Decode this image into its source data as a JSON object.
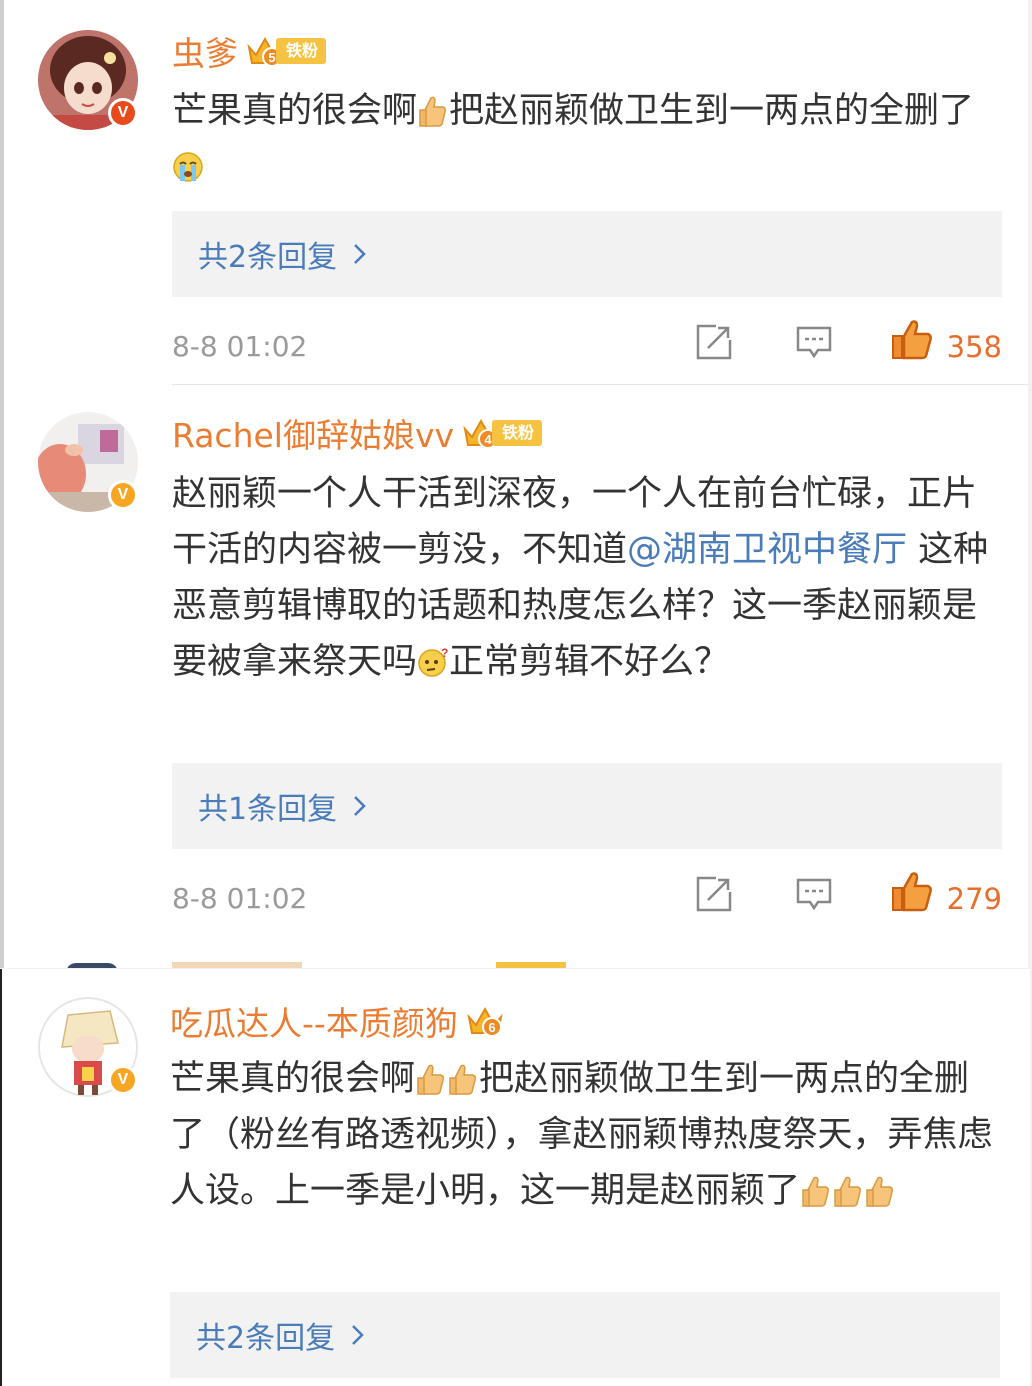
{
  "comments": [
    {
      "username": "虫爹",
      "fan_badge": "铁粉",
      "fan_level": "5",
      "verified": "V",
      "text_before": "芒果真的很会啊",
      "text_mid": "把赵丽颖做卫生到一两点的全删了",
      "reply_link": "共2条回复",
      "time": "8-8 01:02",
      "likes": "358"
    },
    {
      "username": "Rachel御辞姑娘vv",
      "fan_badge": "铁粉",
      "fan_level": "4",
      "verified": "V",
      "text_before": "赵丽颖一个人干活到深夜，一个人在前台忙碌，正片干活的内容被一剪没，不知道",
      "mention": "@湖南卫视中餐厅",
      "text_after": " 这种恶意剪辑博取的话题和热度怎么样？这一季赵丽颖是要被拿来祭天吗",
      "text_end": "正常剪辑不好么？",
      "reply_link": "共1条回复",
      "time": "8-8 01:02",
      "likes": "279"
    },
    {
      "username": "吃瓜达人--本质颜狗",
      "fan_level": "6",
      "verified": "V",
      "text_before": "芒果真的很会啊",
      "text_mid": "把赵丽颖做卫生到一两点的全删了（粉丝有路透视频），拿赵丽颖博热度祭天，弄焦虑人设。上一季是小明，这一期是赵丽颖了",
      "reply_link": "共2条回复"
    }
  ],
  "icons": {
    "share": "share-icon",
    "comment": "comment-icon",
    "like": "thumbs-up-icon",
    "emoji_thumb": "thumbs-up-emoji",
    "emoji_cry": "crying-emoji",
    "emoji_think": "thinking-emoji"
  },
  "colors": {
    "username": "#eb7d33",
    "mention": "#4a7cba",
    "likes": "#e76f2b",
    "fan_badge": "#f5c341",
    "verified_gold": "#f6a623",
    "verified_red": "#e84a1c"
  }
}
